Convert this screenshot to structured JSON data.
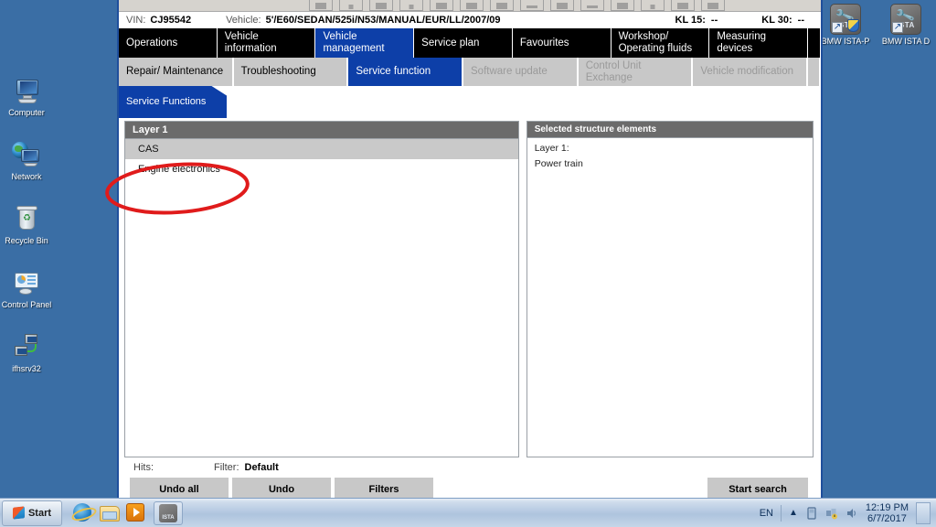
{
  "desktop": {
    "icons": [
      {
        "label": "Computer",
        "icon": "computer-icon"
      },
      {
        "label": "Network",
        "icon": "network-icon"
      },
      {
        "label": "Recycle Bin",
        "icon": "recycle-bin-icon"
      },
      {
        "label": "Control Panel",
        "icon": "control-panel-icon"
      },
      {
        "label": "ifhsrv32",
        "icon": "server-shortcut-icon"
      }
    ],
    "ista_icons": [
      {
        "label": "BMW ISTA-P",
        "icon": "ista-p-icon",
        "tile_text": "ISTA"
      },
      {
        "label": "BMW ISTA D",
        "icon": "ista-d-icon",
        "tile_text": "ISTA"
      }
    ]
  },
  "app": {
    "infobar": {
      "vin_label": "VIN:",
      "vin_value": "CJ95542",
      "vehicle_label": "Vehicle:",
      "vehicle_value": "5'/E60/SEDAN/525i/N53/MANUAL/EUR/LL/2007/09",
      "kl15_label": "KL 15:",
      "kl15_value": "--",
      "kl30_label": "KL 30:",
      "kl30_value": "--"
    },
    "main_tabs": [
      {
        "label": "Operations",
        "active": false
      },
      {
        "label": "Vehicle information",
        "active": false
      },
      {
        "label": "Vehicle management",
        "active": true
      },
      {
        "label": "Service plan",
        "active": false
      },
      {
        "label": "Favourites",
        "active": false
      },
      {
        "label": "Workshop/ Operating fluids",
        "active": false
      },
      {
        "label": "Measuring devices",
        "active": false
      }
    ],
    "sub_tabs": [
      {
        "label": "Repair/ Maintenance",
        "active": false,
        "disabled": false
      },
      {
        "label": "Troubleshooting",
        "active": false,
        "disabled": false
      },
      {
        "label": "Service function",
        "active": true,
        "disabled": false
      },
      {
        "label": "Software update",
        "active": false,
        "disabled": true
      },
      {
        "label": "Control Unit Exchange",
        "active": false,
        "disabled": true
      },
      {
        "label": "Vehicle modification",
        "active": false,
        "disabled": true
      }
    ],
    "breadcrumb": "Service Functions",
    "left_pane": {
      "title": "Layer 1",
      "items": [
        {
          "label": "CAS",
          "selected": true
        },
        {
          "label": "Engine electronics",
          "selected": false
        }
      ]
    },
    "right_pane": {
      "title": "Selected structure elements",
      "line1": "Layer 1:",
      "line2": "Power train"
    },
    "status": {
      "hits_label": "Hits:",
      "hits_value": "",
      "filter_label": "Filter:",
      "filter_value": "Default"
    },
    "buttons": {
      "undo_all": "Undo all",
      "undo": "Undo",
      "filters": "Filters",
      "start_search": "Start search"
    },
    "accent_color": "#0d3fa8",
    "header_gray": "#6b6b6b"
  },
  "taskbar": {
    "start_label": "Start",
    "quick_launch": [
      {
        "name": "internet-explorer-icon"
      },
      {
        "name": "explorer-folder-icon"
      },
      {
        "name": "media-player-icon"
      }
    ],
    "task_items": [
      {
        "name": "ista-task-button",
        "tile_text": "ISTA"
      }
    ],
    "tray": {
      "language": "EN",
      "time": "12:19 PM",
      "date": "6/7/2017",
      "icons": [
        "show-hidden-icons",
        "removable-media-icon",
        "network-warning-icon",
        "volume-icon"
      ]
    }
  },
  "annotation": {
    "shape": "ellipse",
    "color": "#e01b1b",
    "targets": "Engine electronics"
  }
}
